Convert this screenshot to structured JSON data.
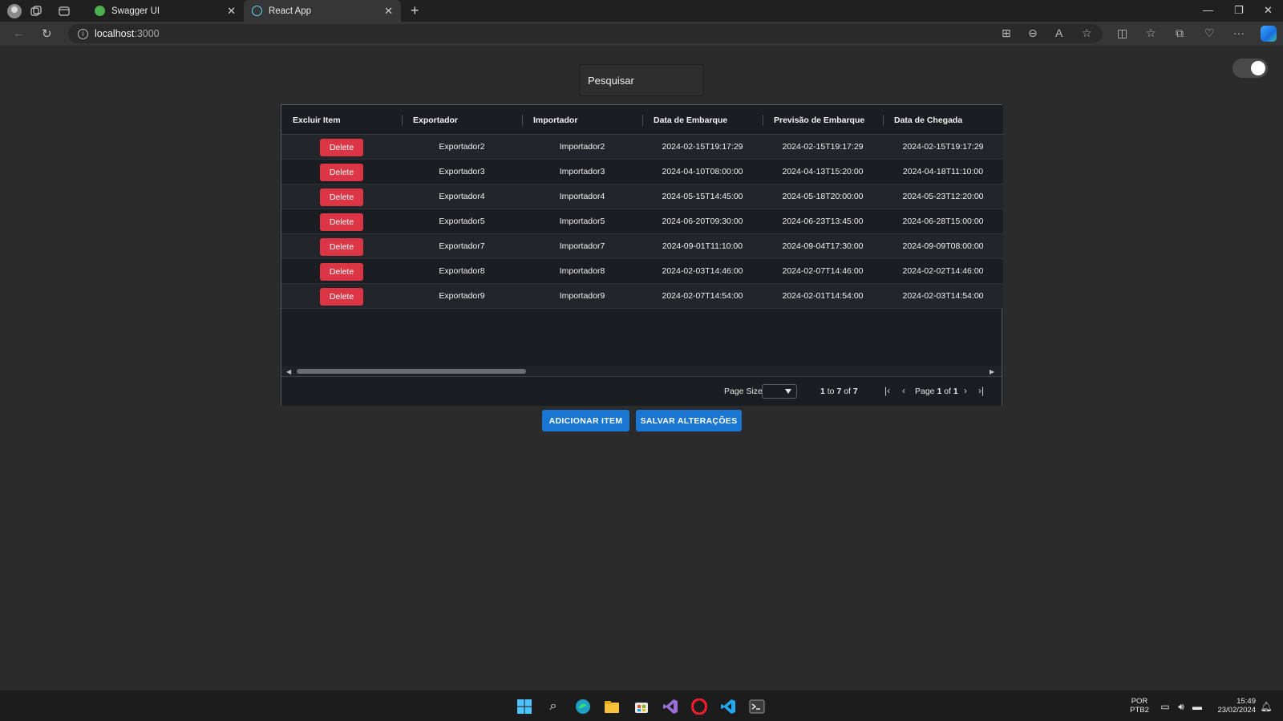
{
  "browser": {
    "tabs": [
      {
        "title": "Swagger UI",
        "favicon_color": "#4caf50"
      },
      {
        "title": "React App",
        "favicon_color": "#61dafb"
      }
    ],
    "url_host": "localhost",
    "url_port": ":3000"
  },
  "page": {
    "search_label": "Pesquisar",
    "grid": {
      "columns": [
        "Excluir Item",
        "Exportador",
        "Importador",
        "Data de Embarque",
        "Previsão de Embarque",
        "Data de Chegada"
      ],
      "delete_label": "Delete",
      "rows": [
        {
          "exportador": "Exportador2",
          "importador": "Importador2",
          "data_embarque": "2024-02-15T19:17:29",
          "previsao_embarque": "2024-02-15T19:17:29",
          "data_chegada": "2024-02-15T19:17:29"
        },
        {
          "exportador": "Exportador3",
          "importador": "Importador3",
          "data_embarque": "2024-04-10T08:00:00",
          "previsao_embarque": "2024-04-13T15:20:00",
          "data_chegada": "2024-04-18T11:10:00"
        },
        {
          "exportador": "Exportador4",
          "importador": "Importador4",
          "data_embarque": "2024-05-15T14:45:00",
          "previsao_embarque": "2024-05-18T20:00:00",
          "data_chegada": "2024-05-23T12:20:00"
        },
        {
          "exportador": "Exportador5",
          "importador": "Importador5",
          "data_embarque": "2024-06-20T09:30:00",
          "previsao_embarque": "2024-06-23T13:45:00",
          "data_chegada": "2024-06-28T15:00:00"
        },
        {
          "exportador": "Exportador7",
          "importador": "Importador7",
          "data_embarque": "2024-09-01T11:10:00",
          "previsao_embarque": "2024-09-04T17:30:00",
          "data_chegada": "2024-09-09T08:00:00"
        },
        {
          "exportador": "Exportador8",
          "importador": "Importador8",
          "data_embarque": "2024-02-03T14:46:00",
          "previsao_embarque": "2024-02-07T14:46:00",
          "data_chegada": "2024-02-02T14:46:00"
        },
        {
          "exportador": "Exportador9",
          "importador": "Importador9",
          "data_embarque": "2024-02-07T14:54:00",
          "previsao_embarque": "2024-02-01T14:54:00",
          "data_chegada": "2024-02-03T14:54:00"
        }
      ],
      "paging": {
        "page_size_label": "Page Size:",
        "range_from": "1",
        "range_to_word": "to",
        "range_to": "7",
        "of_word": "of",
        "total": "7",
        "page_word": "Page",
        "page": "1",
        "page_of_word": "of",
        "page_count": "1"
      }
    },
    "buttons": {
      "add": "ADICIONAR ITEM",
      "save": "SALVAR ALTERAÇÕES"
    },
    "toggle_on": true
  },
  "taskbar": {
    "lang_top": "POR",
    "lang_bottom": "PTB2",
    "time": "15:49",
    "date": "23/02/2024"
  },
  "colors": {
    "delete": "#dc3545",
    "primary": "#1976d2"
  }
}
